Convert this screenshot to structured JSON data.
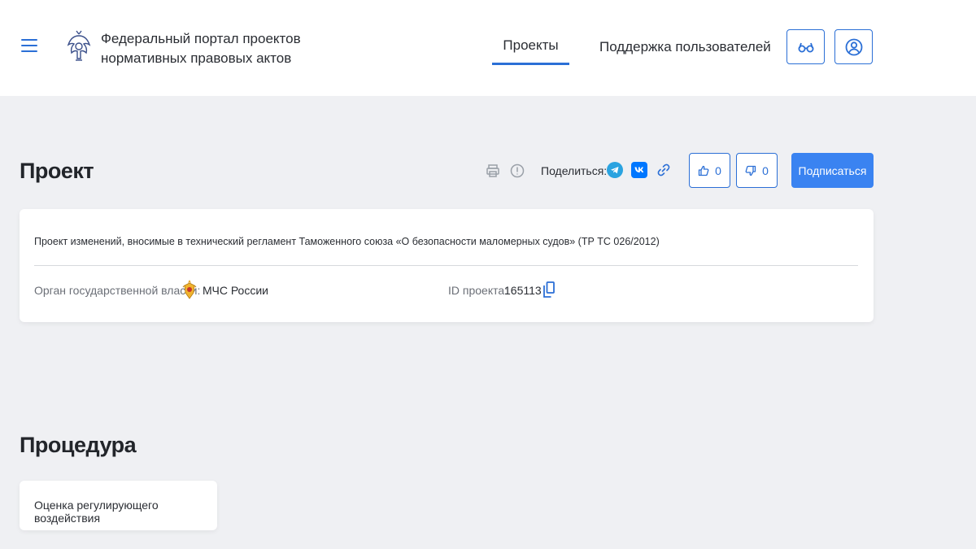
{
  "header": {
    "portal_title_line1": "Федеральный портал проектов",
    "portal_title_line2": "нормативных правовых актов",
    "nav": [
      {
        "label": "Проекты",
        "active": true
      },
      {
        "label": "Поддержка пользователей",
        "active": false
      }
    ],
    "icons": [
      "menu-icon",
      "emblem-icon",
      "glasses-icon",
      "user-icon"
    ]
  },
  "project": {
    "heading": "Проект",
    "share_label": "Поделиться:",
    "likes": "0",
    "dislikes": "0",
    "subscribe_label": "Подписаться",
    "description": "Проект изменений, вносимые в технический регламент Таможенного союза «О безопасности маломерных судов» (ТР ТС 026/2012)",
    "organ_label": "Орган государственной власти:",
    "organ_value": "МЧС России",
    "id_label": "ID проекта:",
    "id_value": "165113"
  },
  "procedure": {
    "heading": "Процедура",
    "stage_label": "Оценка регулирующего воздействия"
  },
  "colors": {
    "accent": "#2b6fd6",
    "subscribe_bg": "#3a83f1",
    "page_bg": "#eff0f3",
    "telegram": "#2aa3e0",
    "vk": "#0077ff"
  }
}
